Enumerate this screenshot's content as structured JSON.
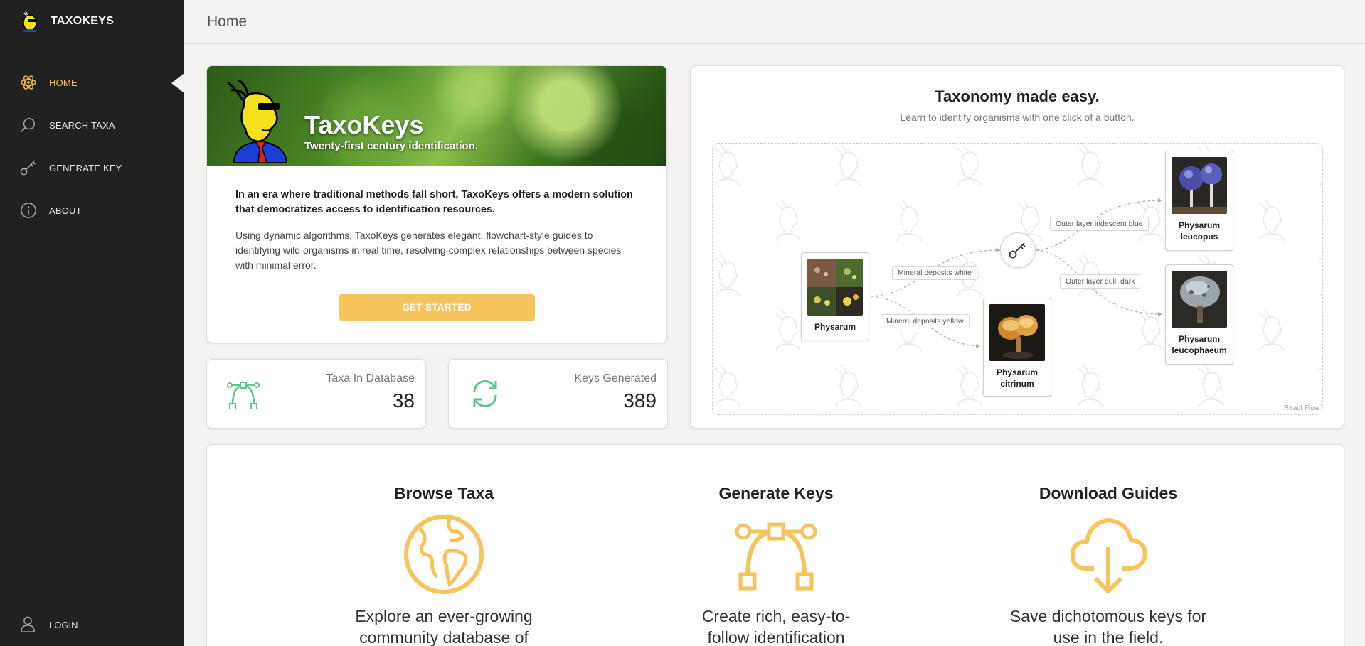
{
  "app": {
    "brand": "TAXOKEYS"
  },
  "sidebar": {
    "items": [
      {
        "label": "HOME",
        "icon": "atom-icon",
        "active": true
      },
      {
        "label": "SEARCH TAXA",
        "icon": "search-icon",
        "active": false
      },
      {
        "label": "GENERATE KEY",
        "icon": "key-icon",
        "active": false
      },
      {
        "label": "ABOUT",
        "icon": "info-icon",
        "active": false
      }
    ],
    "login": {
      "label": "LOGIN",
      "icon": "user-icon"
    }
  },
  "header": {
    "title": "Home"
  },
  "hero": {
    "name": "TaxoKeys",
    "tagline": "Twenty-first century identification.",
    "lead": "In an era where traditional methods fall short, TaxoKeys offers a modern solution that democratizes access to identification resources.",
    "description": "Using dynamic algorithms, TaxoKeys generates elegant, flowchart-style guides to identifying wild organisms in real time, resolving complex relationships between species with minimal error.",
    "button": "GET STARTED"
  },
  "stats": [
    {
      "label": "Taxa In Database",
      "value": "38",
      "icon": "bezier-icon"
    },
    {
      "label": "Keys Generated",
      "value": "389",
      "icon": "refresh-icon"
    }
  ],
  "flowchart": {
    "title": "Taxonomy made easy.",
    "subtitle": "Learn to identify organisms with one click of a button.",
    "nodes": {
      "root": "Physarum",
      "citrinum": "Physarum citrinum",
      "leucopus": "Physarum leucopus",
      "leucophaeum": "Physarum leucophaeum"
    },
    "edges": {
      "white": "Mineral deposits white",
      "yellow": "Mineral deposits yellow",
      "blue": "Outer layer iridescent blue",
      "dark": "Outer layer dull, dark"
    },
    "attribution": "React Flow"
  },
  "features": [
    {
      "title": "Browse Taxa",
      "icon": "globe-icon",
      "text": "Explore an ever-growing community database of"
    },
    {
      "title": "Generate Keys",
      "icon": "bezier-icon",
      "text": "Create rich, easy-to-follow identification"
    },
    {
      "title": "Download Guides",
      "icon": "cloud-download-icon",
      "text": "Save dichotomous keys for use in the field."
    }
  ],
  "colors": {
    "accent": "#f6bf4f",
    "sidebar": "#212121",
    "stat_icon": "#5fc58a"
  }
}
